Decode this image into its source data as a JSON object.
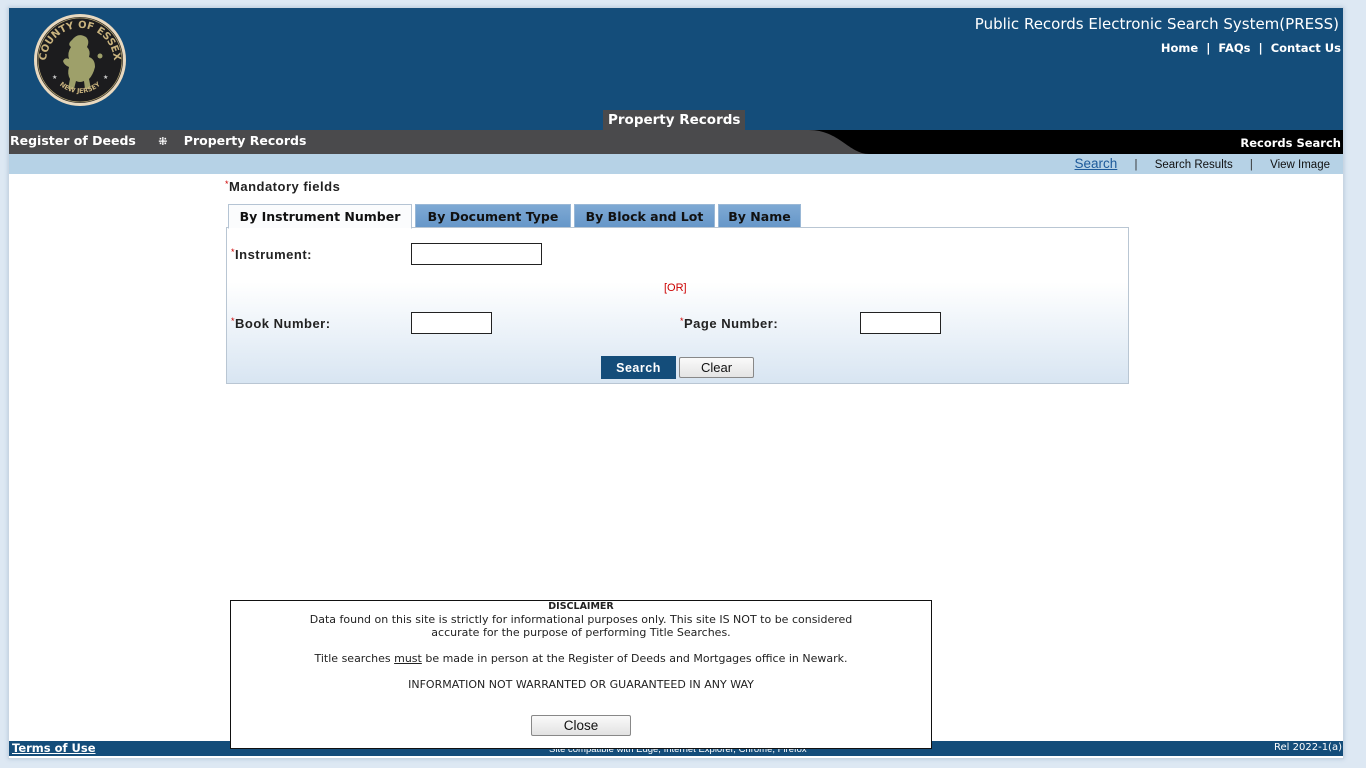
{
  "header": {
    "logo_alt": "County of Essex New Jersey seal",
    "logo_text_top": "COUNTY OF ESSEX",
    "logo_text_bottom": "NEW JERSEY",
    "app_title": "Public Records Electronic Search System(PRESS)",
    "links": [
      {
        "label": "Home"
      },
      {
        "label": "FAQs"
      },
      {
        "label": "Contact Us"
      }
    ],
    "section_tab": "Property Records"
  },
  "navbar": {
    "breadcrumb": [
      "Register of Deeds",
      "Property Records"
    ],
    "right_label": "Records Search"
  },
  "subnav": {
    "items": [
      {
        "label": "Search",
        "active": true
      },
      {
        "label": "Search Results",
        "active": false
      },
      {
        "label": "View Image",
        "active": false
      }
    ]
  },
  "form": {
    "mandatory_note": "Mandatory fields",
    "required_marker": "*",
    "tabs": [
      {
        "label": "By Instrument Number",
        "active": true
      },
      {
        "label": "By Document Type",
        "active": false
      },
      {
        "label": "By Block and Lot",
        "active": false
      },
      {
        "label": "By Name",
        "active": false
      }
    ],
    "fields": {
      "instrument": {
        "label": "Instrument:",
        "value": ""
      },
      "or_label": "[OR]",
      "book_number": {
        "label": "Book Number:",
        "value": ""
      },
      "page_number": {
        "label": "Page Number:",
        "value": ""
      }
    },
    "search_button": "Search",
    "clear_button": "Clear"
  },
  "disclaimer": {
    "title": "DISCLAIMER",
    "line1": "Data found on this site is strictly for informational purposes only. This site IS NOT to be considered",
    "line2": "accurate for the purpose of performing Title Searches.",
    "line3_pre": "Title searches ",
    "line3_emph": "must",
    "line3_post": " be made in person at the Register of Deeds and Mortgages office in Newark.",
    "line4": "INFORMATION NOT WARRANTED OR GUARANTEED IN ANY WAY",
    "close_button": "Close"
  },
  "footer": {
    "terms": "Terms of Use",
    "compat": "Site compatible with Edge, Internet Explorer, Chrome, Firefox",
    "release": "Rel 2022-1(a)"
  },
  "colors": {
    "brand_blue": "#144d7a",
    "nav_gray": "#4a4a4c",
    "subnav_blue": "#b6d2e6",
    "tab_blue": "#6f9dcc",
    "required_red": "#cc0000"
  }
}
